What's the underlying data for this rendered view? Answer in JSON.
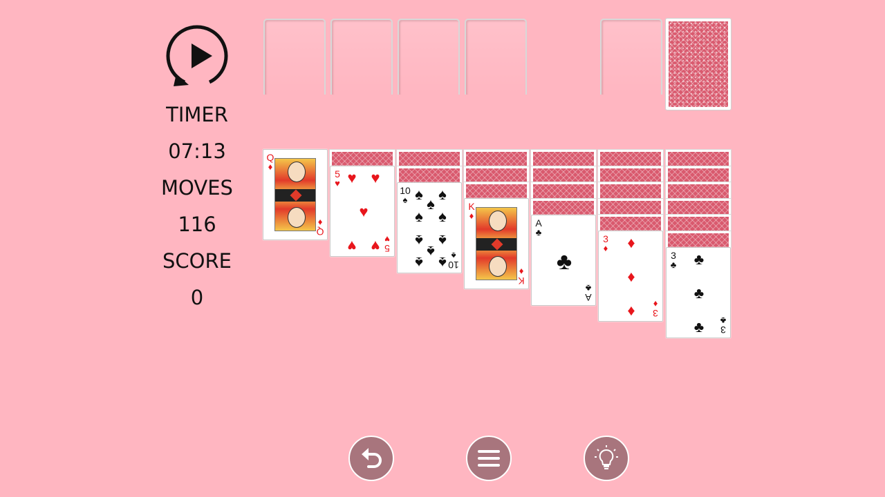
{
  "stats": {
    "timer_label": "TIMER",
    "timer_value": "07:13",
    "moves_label": "MOVES",
    "moves_value": "116",
    "score_label": "SCORE",
    "score_value": "0"
  },
  "controls": {
    "replay_icon": "replay-icon",
    "undo_icon": "undo-icon",
    "menu_icon": "menu-icon",
    "hint_icon": "lightbulb-icon"
  },
  "colors": {
    "background": "#ffb6c1",
    "card_back": "#d95a6e",
    "button": "#a8757d",
    "red_suit": "#e8161c",
    "black_suit": "#111111"
  },
  "tableau": [
    {
      "face_down": 0,
      "rank": "Q",
      "suit": "♦"
    },
    {
      "face_down": 1,
      "rank": "5",
      "suit": "♥"
    },
    {
      "face_down": 2,
      "rank": "10",
      "suit": "♠"
    },
    {
      "face_down": 3,
      "rank": "K",
      "suit": "♦"
    },
    {
      "face_down": 4,
      "rank": "A",
      "suit": "♣"
    },
    {
      "face_down": 5,
      "rank": "3",
      "suit": "♦"
    },
    {
      "face_down": 6,
      "rank": "3",
      "suit": "♣"
    }
  ]
}
